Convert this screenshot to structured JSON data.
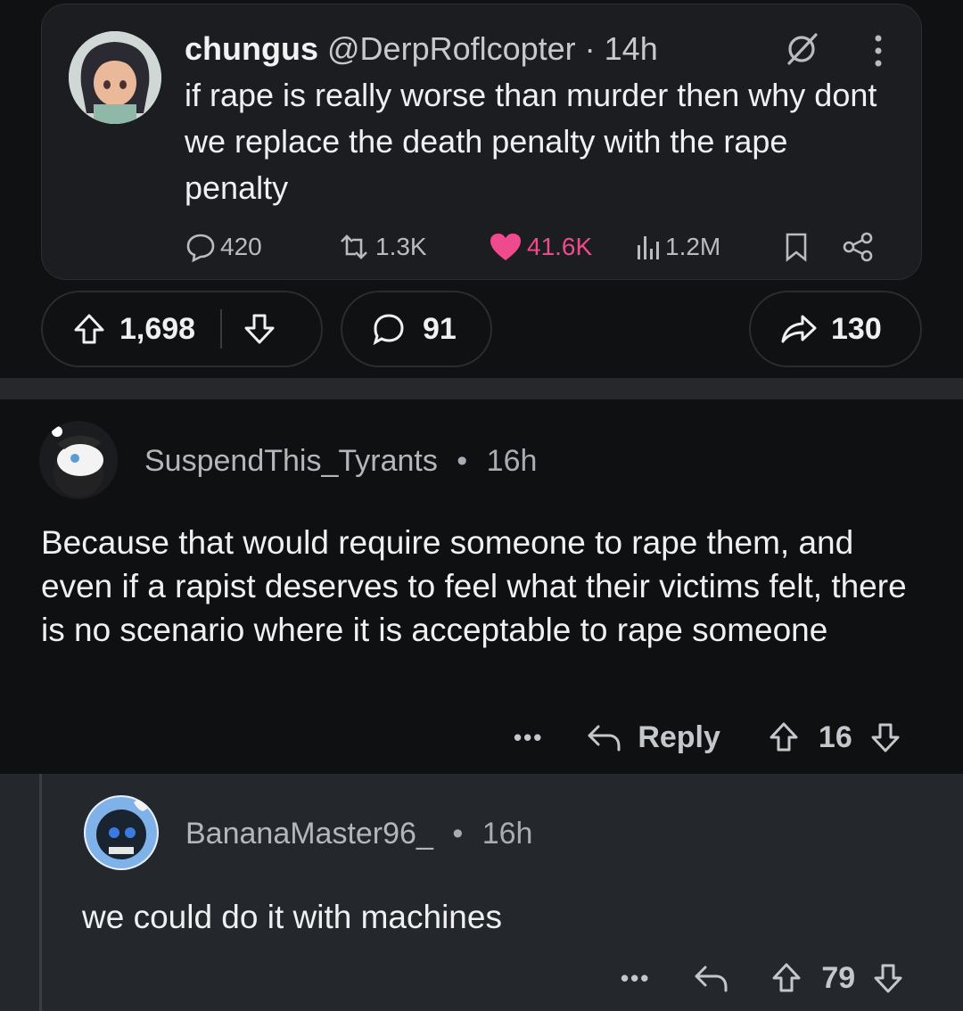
{
  "embed": {
    "name": "chungus",
    "handle": "@DerpRoflcopter · 14h",
    "text": "if rape is really worse than murder then why dont we replace the death penalty with the rape penalty",
    "replies": "420",
    "retweets": "1.3K",
    "likes": "41.6K",
    "views": "1.2M",
    "like_color": "#f04a8e"
  },
  "post_bar": {
    "upvotes": "1,698",
    "comments": "91",
    "shares": "130"
  },
  "comments": [
    {
      "user": "SuspendThis_Tyrants",
      "time": "16h",
      "text": "Because that would require someone to rape them, and even if a rapist deserves to feel what their victims felt, there is no scenario where it is acceptable to rape someone",
      "more": "•••",
      "reply_label": "Reply",
      "score": "16"
    },
    {
      "user": "BananaMaster96_",
      "time": "16h",
      "text": "we could do it with machines",
      "more": "•••",
      "score": "79"
    }
  ],
  "separator": "•"
}
